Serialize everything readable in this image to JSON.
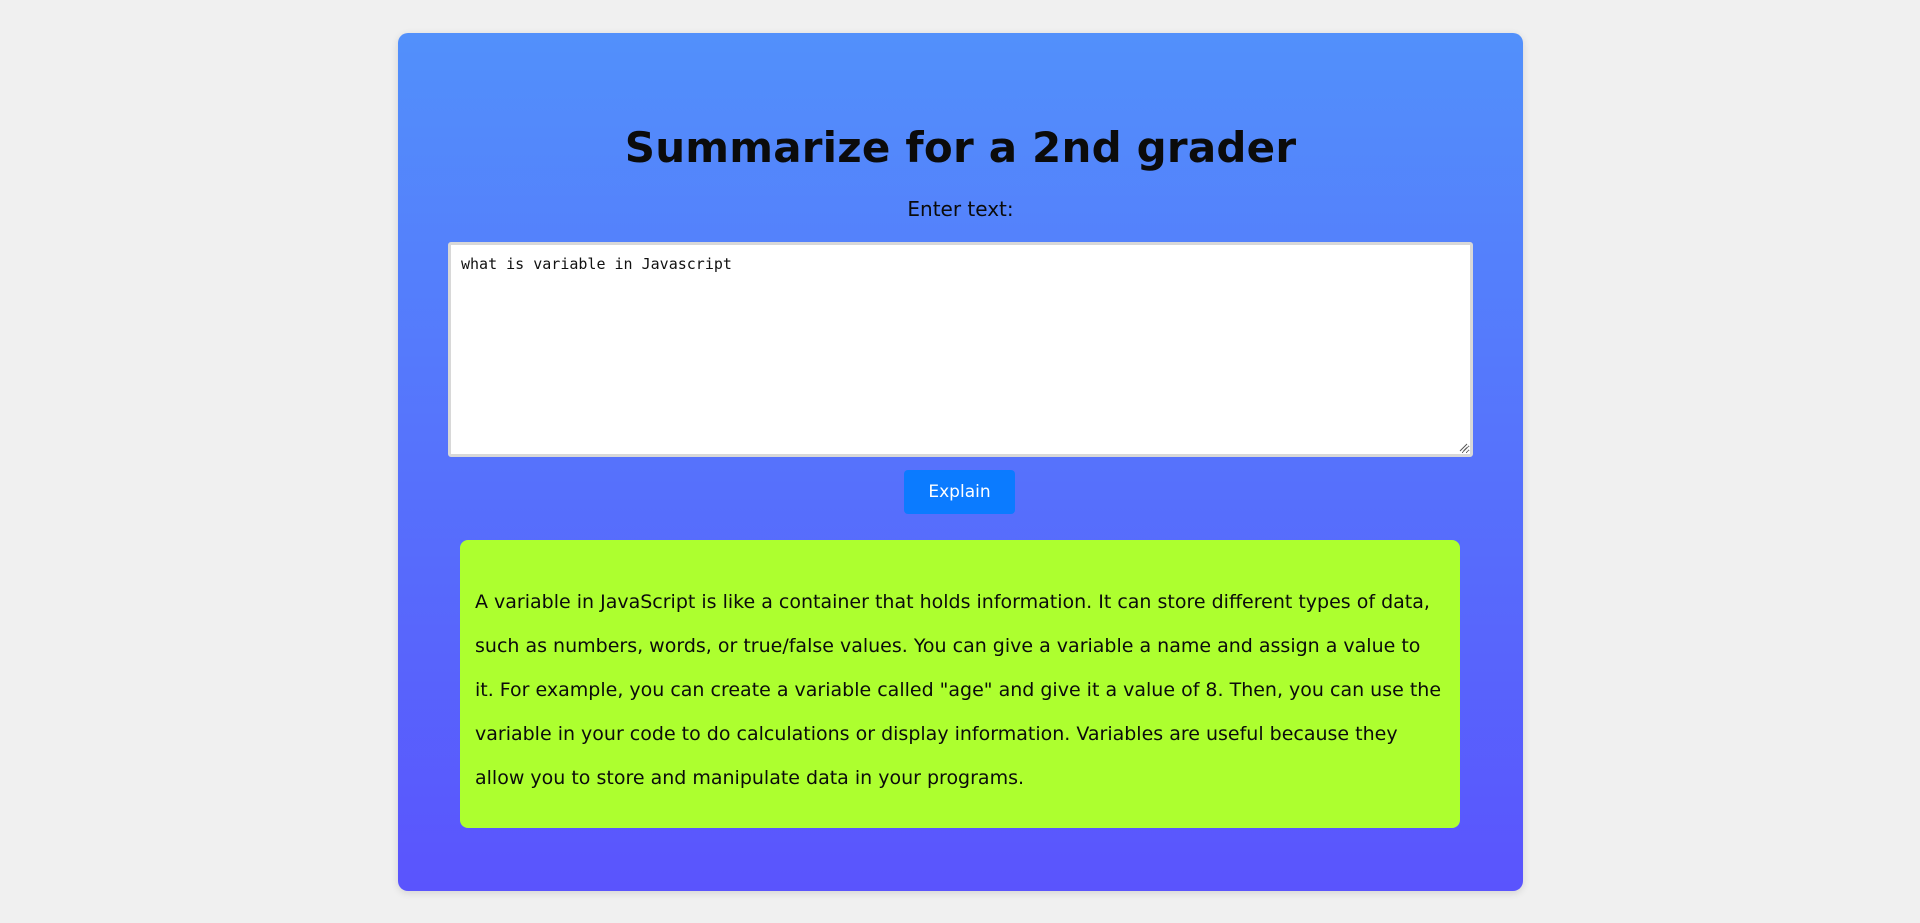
{
  "page": {
    "title": "Summarize for a 2nd grader",
    "input_label": "Enter text:",
    "input_value": "what is variable in Javascript",
    "button_label": "Explain",
    "result_text": "A variable in JavaScript is like a container that holds information. It can store different types of data, such as numbers, words, or true/false values. You can give a variable a name and assign a value to it. For example, you can create a variable called \"age\" and give it a value of 8. Then, you can use the variable in your code to do calculations or display information. Variables are useful because they allow you to store and manipulate data in your programs."
  },
  "colors": {
    "background": "#f0f0f0",
    "card_gradient_top": "#5290fb",
    "card_gradient_bottom": "#5a54fd",
    "button": "#0b7bff",
    "result_box": "#adff2f"
  }
}
